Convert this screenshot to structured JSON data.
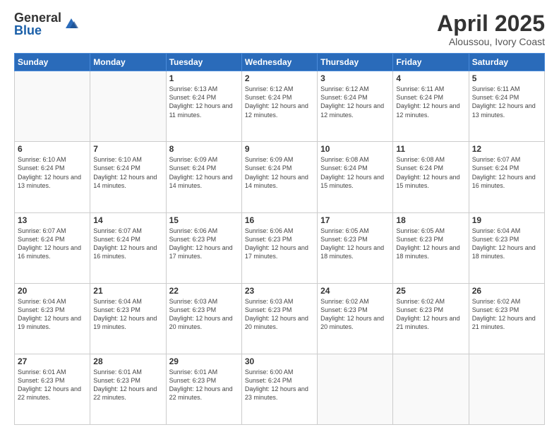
{
  "logo": {
    "general": "General",
    "blue": "Blue"
  },
  "title": "April 2025",
  "subtitle": "Aloussou, Ivory Coast",
  "weekdays": [
    "Sunday",
    "Monday",
    "Tuesday",
    "Wednesday",
    "Thursday",
    "Friday",
    "Saturday"
  ],
  "weeks": [
    [
      {
        "day": "",
        "info": ""
      },
      {
        "day": "",
        "info": ""
      },
      {
        "day": "1",
        "info": "Sunrise: 6:13 AM\nSunset: 6:24 PM\nDaylight: 12 hours and 11 minutes."
      },
      {
        "day": "2",
        "info": "Sunrise: 6:12 AM\nSunset: 6:24 PM\nDaylight: 12 hours and 12 minutes."
      },
      {
        "day": "3",
        "info": "Sunrise: 6:12 AM\nSunset: 6:24 PM\nDaylight: 12 hours and 12 minutes."
      },
      {
        "day": "4",
        "info": "Sunrise: 6:11 AM\nSunset: 6:24 PM\nDaylight: 12 hours and 12 minutes."
      },
      {
        "day": "5",
        "info": "Sunrise: 6:11 AM\nSunset: 6:24 PM\nDaylight: 12 hours and 13 minutes."
      }
    ],
    [
      {
        "day": "6",
        "info": "Sunrise: 6:10 AM\nSunset: 6:24 PM\nDaylight: 12 hours and 13 minutes."
      },
      {
        "day": "7",
        "info": "Sunrise: 6:10 AM\nSunset: 6:24 PM\nDaylight: 12 hours and 14 minutes."
      },
      {
        "day": "8",
        "info": "Sunrise: 6:09 AM\nSunset: 6:24 PM\nDaylight: 12 hours and 14 minutes."
      },
      {
        "day": "9",
        "info": "Sunrise: 6:09 AM\nSunset: 6:24 PM\nDaylight: 12 hours and 14 minutes."
      },
      {
        "day": "10",
        "info": "Sunrise: 6:08 AM\nSunset: 6:24 PM\nDaylight: 12 hours and 15 minutes."
      },
      {
        "day": "11",
        "info": "Sunrise: 6:08 AM\nSunset: 6:24 PM\nDaylight: 12 hours and 15 minutes."
      },
      {
        "day": "12",
        "info": "Sunrise: 6:07 AM\nSunset: 6:24 PM\nDaylight: 12 hours and 16 minutes."
      }
    ],
    [
      {
        "day": "13",
        "info": "Sunrise: 6:07 AM\nSunset: 6:24 PM\nDaylight: 12 hours and 16 minutes."
      },
      {
        "day": "14",
        "info": "Sunrise: 6:07 AM\nSunset: 6:24 PM\nDaylight: 12 hours and 16 minutes."
      },
      {
        "day": "15",
        "info": "Sunrise: 6:06 AM\nSunset: 6:23 PM\nDaylight: 12 hours and 17 minutes."
      },
      {
        "day": "16",
        "info": "Sunrise: 6:06 AM\nSunset: 6:23 PM\nDaylight: 12 hours and 17 minutes."
      },
      {
        "day": "17",
        "info": "Sunrise: 6:05 AM\nSunset: 6:23 PM\nDaylight: 12 hours and 18 minutes."
      },
      {
        "day": "18",
        "info": "Sunrise: 6:05 AM\nSunset: 6:23 PM\nDaylight: 12 hours and 18 minutes."
      },
      {
        "day": "19",
        "info": "Sunrise: 6:04 AM\nSunset: 6:23 PM\nDaylight: 12 hours and 18 minutes."
      }
    ],
    [
      {
        "day": "20",
        "info": "Sunrise: 6:04 AM\nSunset: 6:23 PM\nDaylight: 12 hours and 19 minutes."
      },
      {
        "day": "21",
        "info": "Sunrise: 6:04 AM\nSunset: 6:23 PM\nDaylight: 12 hours and 19 minutes."
      },
      {
        "day": "22",
        "info": "Sunrise: 6:03 AM\nSunset: 6:23 PM\nDaylight: 12 hours and 20 minutes."
      },
      {
        "day": "23",
        "info": "Sunrise: 6:03 AM\nSunset: 6:23 PM\nDaylight: 12 hours and 20 minutes."
      },
      {
        "day": "24",
        "info": "Sunrise: 6:02 AM\nSunset: 6:23 PM\nDaylight: 12 hours and 20 minutes."
      },
      {
        "day": "25",
        "info": "Sunrise: 6:02 AM\nSunset: 6:23 PM\nDaylight: 12 hours and 21 minutes."
      },
      {
        "day": "26",
        "info": "Sunrise: 6:02 AM\nSunset: 6:23 PM\nDaylight: 12 hours and 21 minutes."
      }
    ],
    [
      {
        "day": "27",
        "info": "Sunrise: 6:01 AM\nSunset: 6:23 PM\nDaylight: 12 hours and 22 minutes."
      },
      {
        "day": "28",
        "info": "Sunrise: 6:01 AM\nSunset: 6:23 PM\nDaylight: 12 hours and 22 minutes."
      },
      {
        "day": "29",
        "info": "Sunrise: 6:01 AM\nSunset: 6:23 PM\nDaylight: 12 hours and 22 minutes."
      },
      {
        "day": "30",
        "info": "Sunrise: 6:00 AM\nSunset: 6:24 PM\nDaylight: 12 hours and 23 minutes."
      },
      {
        "day": "",
        "info": ""
      },
      {
        "day": "",
        "info": ""
      },
      {
        "day": "",
        "info": ""
      }
    ]
  ]
}
